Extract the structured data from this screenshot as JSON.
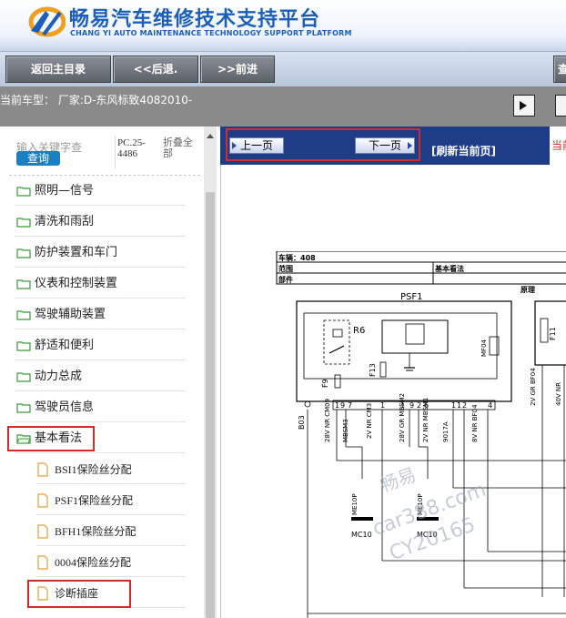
{
  "header": {
    "title_cn": "畅易汽车维修技术支持平台",
    "title_en": "CHANG YI AUTO MAINTENANCE TECHNOLOGY SUPPORT PLATFORM"
  },
  "toolbar": {
    "home_label": "返回主目录",
    "back_label": "<<后退.",
    "forward_label": ">>前进",
    "partial_label": "查"
  },
  "vehicle": {
    "label": "当前车型：  厂家:D-东风标致4082010-"
  },
  "search": {
    "placeholder": "输入关键字查",
    "query_label": "查询",
    "code": "PC.25-4486",
    "collapse": "折叠全部"
  },
  "tree": {
    "items": [
      {
        "label": "照明—信号"
      },
      {
        "label": "清洗和雨刮"
      },
      {
        "label": "防护装置和车门"
      },
      {
        "label": "仪表和控制装置"
      },
      {
        "label": "驾驶辅助装置"
      },
      {
        "label": "舒适和便利"
      },
      {
        "label": "动力总成"
      },
      {
        "label": "驾驶员信息"
      },
      {
        "label": "基本看法"
      }
    ],
    "sub_items": [
      {
        "label": "BSI1保险丝分配"
      },
      {
        "label": "PSF1保险丝分配"
      },
      {
        "label": "BFH1保险丝分配"
      },
      {
        "label": "0004保险丝分配"
      },
      {
        "label": "诊断插座"
      }
    ]
  },
  "nav": {
    "prev_label": "上一页",
    "next_label": "下一页",
    "refresh_label": "[刷新当前页]",
    "current_label": "当前"
  },
  "diagram": {
    "vehicle_row": "车辆：408",
    "range_label": "范围",
    "part_label": "部件",
    "basic_label": "基本看法",
    "principle_label": "原理",
    "psf_label": "PSF1",
    "r6": "R6",
    "f9": "F9",
    "f13": "F13",
    "f11": "F11",
    "mf04": "MF04",
    "b03": "B03",
    "pins": [
      "1",
      "9",
      "7",
      "1",
      "1",
      "9",
      "2",
      "6",
      "1",
      "1",
      "2",
      "4"
    ],
    "wires": [
      "28V NR CM09",
      "2V NR CM3",
      "28V GR MBSM2",
      "2V NR MBSM1",
      "9017A",
      "8V NR BF04",
      "2V GR BF04",
      "40V NR"
    ],
    "mbsm3": "MBSM3",
    "mc10_a": "MC10",
    "mc10_b": "MC10",
    "me10p_a": "ME10P",
    "me10p_b": "ME10P",
    "watermark_cn": "畅易",
    "watermark_url": "car388.com",
    "watermark_code": "CY20165"
  }
}
